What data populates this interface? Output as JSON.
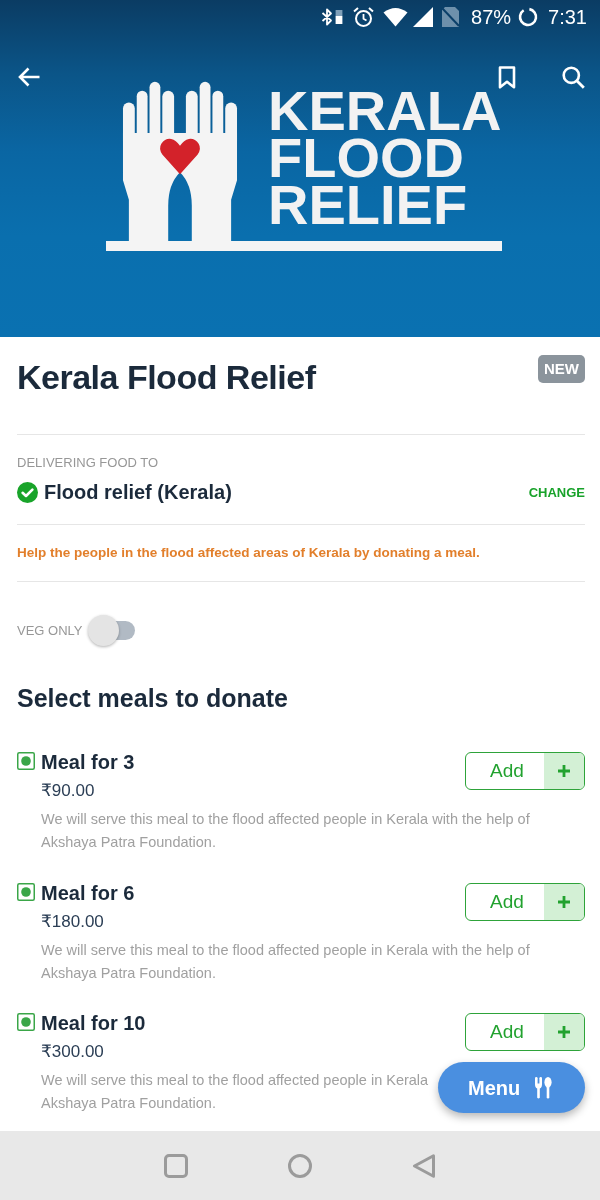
{
  "status_bar": {
    "battery": "87%",
    "time": "7:31"
  },
  "banner": {
    "logo_lines": [
      "KERALA",
      "FLOOD",
      "RELIEF"
    ]
  },
  "header": {
    "title": "Kerala Flood Relief",
    "badge": "NEW"
  },
  "delivery": {
    "label": "DELIVERING FOOD TO",
    "location": "Flood relief (Kerala)",
    "verified": true,
    "action": "CHANGE"
  },
  "notice": "Help the people in the flood affected areas of Kerala by donating a meal.",
  "veg_filter": {
    "label": "VEG ONLY",
    "on": false
  },
  "section_title": "Select meals to donate",
  "meals": [
    {
      "name": "Meal for 3",
      "veg": true,
      "price": "₹90.00",
      "description": "We will serve this meal to the flood affected people in Kerala with the help of Akshaya Patra Foundation.",
      "button": "Add"
    },
    {
      "name": "Meal for 6",
      "veg": true,
      "price": "₹180.00",
      "description": "We will serve this meal to the flood affected people in Kerala with the help of Akshaya Patra Foundation.",
      "button": "Add"
    },
    {
      "name": "Meal for 10",
      "veg": true,
      "price": "₹300.00",
      "description": "We will serve this meal to the flood affected people in Kerala\nAkshaya Patra Foundation.",
      "button": "Add"
    }
  ],
  "fab": {
    "label": "Menu"
  }
}
